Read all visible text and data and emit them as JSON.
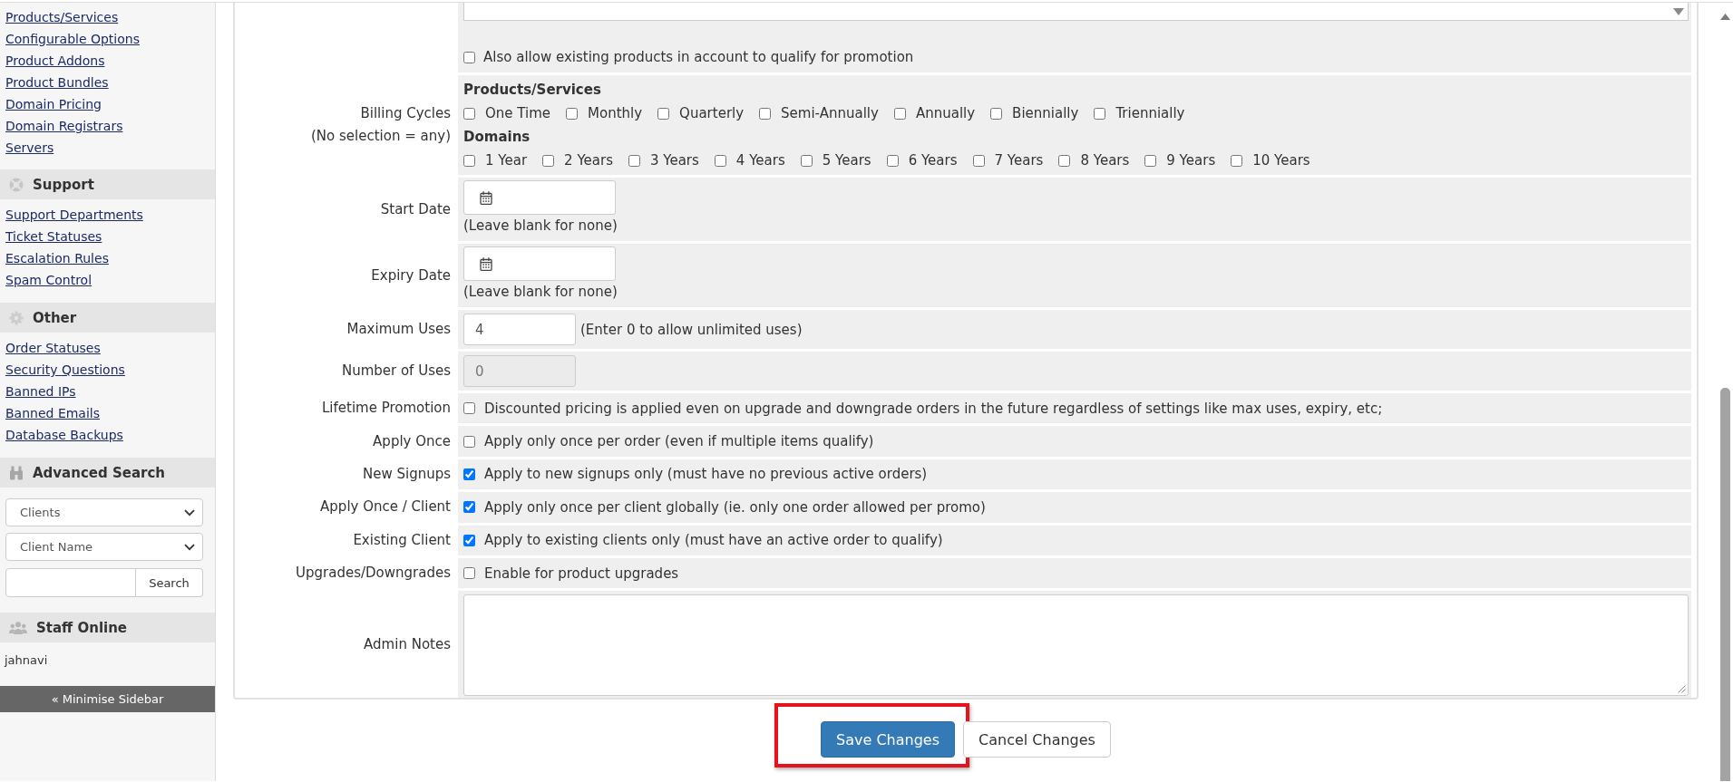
{
  "sidebar": {
    "links": [
      "Products/Services",
      "Configurable Options",
      "Product Addons",
      "Product Bundles",
      "Domain Pricing",
      "Domain Registrars",
      "Servers"
    ],
    "support": {
      "title": "Support",
      "links": [
        "Support Departments",
        "Ticket Statuses",
        "Escalation Rules",
        "Spam Control"
      ]
    },
    "other": {
      "title": "Other",
      "links": [
        "Order Statuses",
        "Security Questions",
        "Banned IPs",
        "Banned Emails",
        "Database Backups"
      ]
    },
    "advanced_search": {
      "title": "Advanced Search",
      "type_select": "Clients",
      "field_select": "Client Name",
      "button": "Search"
    },
    "staff_online": {
      "title": "Staff Online",
      "users": [
        "jahnavi"
      ]
    },
    "minimise": "« Minimise Sidebar"
  },
  "form": {
    "rows": [
      {
        "kind": "listbox_checkbox",
        "checkbox": {
          "label": "Also allow existing products in account to qualify for promotion",
          "checked": false
        }
      },
      {
        "kind": "billing",
        "label": "Billing Cycles",
        "note": "(No selection = any)",
        "groups": [
          {
            "title": "Products/Services",
            "options": [
              {
                "label": "One Time",
                "checked": false
              },
              {
                "label": "Monthly",
                "checked": false
              },
              {
                "label": "Quarterly",
                "checked": false
              },
              {
                "label": "Semi-Annually",
                "checked": false
              },
              {
                "label": "Annually",
                "checked": false
              },
              {
                "label": "Biennially",
                "checked": false
              },
              {
                "label": "Triennially",
                "checked": false
              }
            ]
          },
          {
            "title": "Domains",
            "options": [
              {
                "label": "1 Year",
                "checked": false
              },
              {
                "label": "2 Years",
                "checked": false
              },
              {
                "label": "3 Years",
                "checked": false
              },
              {
                "label": "4 Years",
                "checked": false
              },
              {
                "label": "5 Years",
                "checked": false
              },
              {
                "label": "6 Years",
                "checked": false
              },
              {
                "label": "7 Years",
                "checked": false
              },
              {
                "label": "8 Years",
                "checked": false
              },
              {
                "label": "9 Years",
                "checked": false
              },
              {
                "label": "10 Years",
                "checked": false
              }
            ]
          }
        ]
      },
      {
        "kind": "date",
        "label": "Start Date",
        "hint": "(Leave blank for none)"
      },
      {
        "kind": "date",
        "label": "Expiry Date",
        "hint": "(Leave blank for none)"
      },
      {
        "kind": "number",
        "label": "Maximum Uses",
        "value": "4",
        "disabled": false,
        "hint": "(Enter 0 to allow unlimited uses)"
      },
      {
        "kind": "number",
        "label": "Number of Uses",
        "value": "0",
        "disabled": true
      },
      {
        "kind": "checkbox",
        "label": "Lifetime Promotion",
        "text": "Discounted pricing is applied even on upgrade and downgrade orders in the future regardless of settings like max uses, expiry, etc;",
        "checked": false
      },
      {
        "kind": "checkbox",
        "label": "Apply Once",
        "text": "Apply only once per order (even if multiple items qualify)",
        "checked": false
      },
      {
        "kind": "checkbox",
        "label": "New Signups",
        "text": "Apply to new signups only (must have no previous active orders)",
        "checked": true
      },
      {
        "kind": "checkbox",
        "label": "Apply Once / Client",
        "text": "Apply only once per client globally (ie. only one order allowed per promo)",
        "checked": true
      },
      {
        "kind": "checkbox",
        "label": "Existing Client",
        "text": "Apply to existing clients only (must have an active order to qualify)",
        "checked": true
      },
      {
        "kind": "checkbox",
        "label": "Upgrades/Downgrades",
        "text": "Enable for product upgrades",
        "checked": false
      },
      {
        "kind": "textarea",
        "label": "Admin Notes"
      }
    ]
  },
  "actions": {
    "buttons": [
      {
        "label": "Save Changes",
        "kind": "primary",
        "highlighted": true
      },
      {
        "label": "Cancel Changes",
        "kind": "default",
        "highlighted": false
      }
    ]
  }
}
